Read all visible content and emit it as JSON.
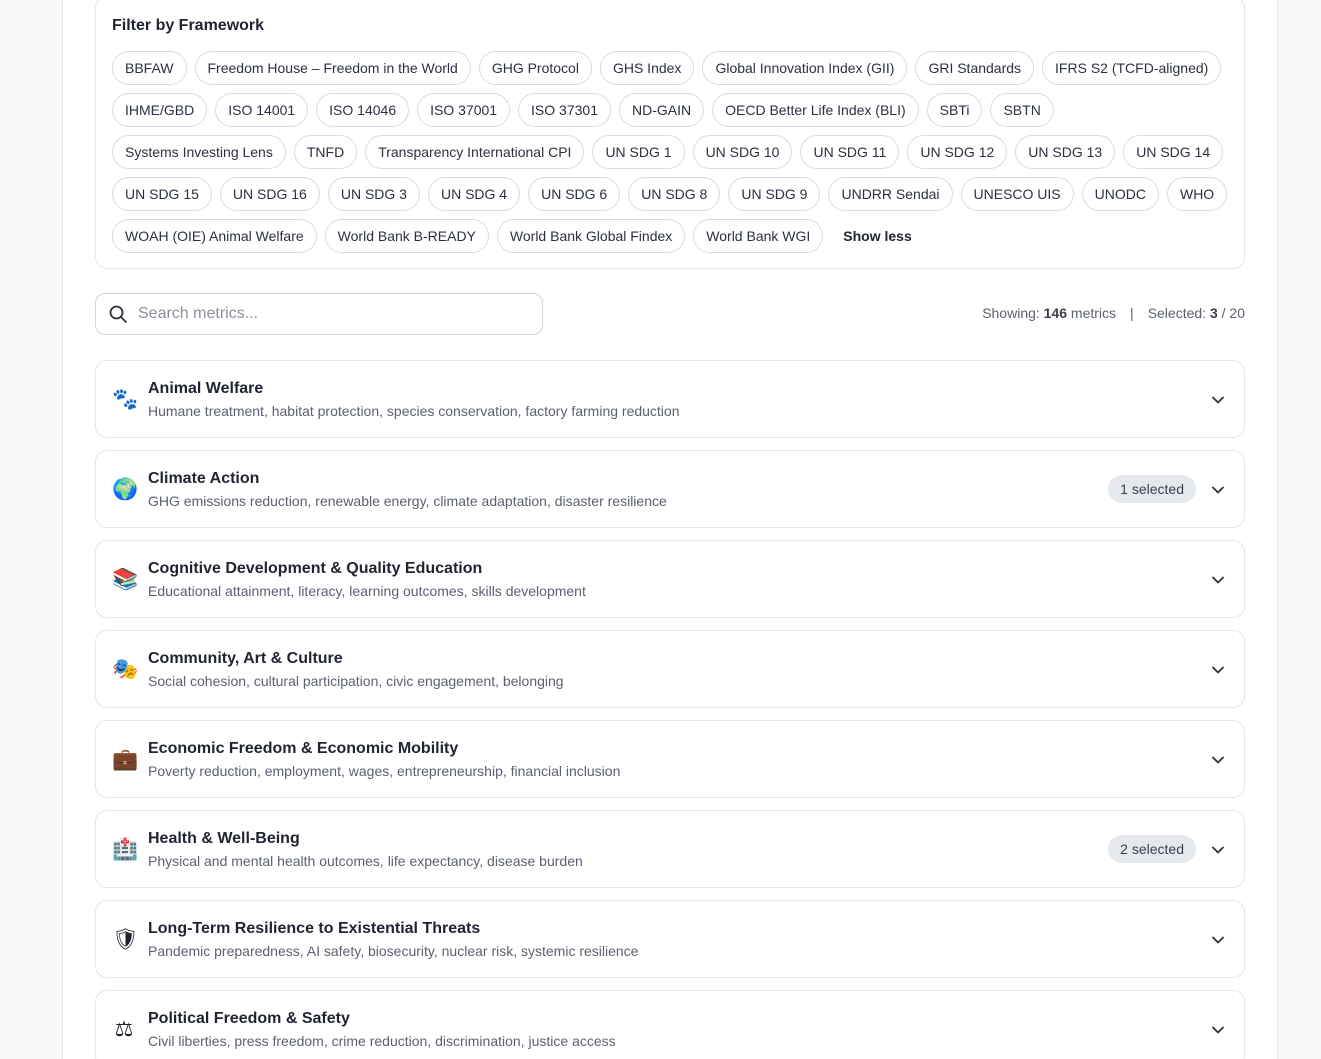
{
  "filter": {
    "title": "Filter by Framework",
    "chips": [
      "BBFAW",
      "Freedom House – Freedom in the World",
      "GHG Protocol",
      "GHS Index",
      "Global Innovation Index (GII)",
      "GRI Standards",
      "IFRS S2 (TCFD-aligned)",
      "IHME/GBD",
      "ISO 14001",
      "ISO 14046",
      "ISO 37001",
      "ISO 37301",
      "ND-GAIN",
      "OECD Better Life Index (BLI)",
      "SBTi",
      "SBTN",
      "Systems Investing Lens",
      "TNFD",
      "Transparency International CPI",
      "UN SDG 1",
      "UN SDG 10",
      "UN SDG 11",
      "UN SDG 12",
      "UN SDG 13",
      "UN SDG 14",
      "UN SDG 15",
      "UN SDG 16",
      "UN SDG 3",
      "UN SDG 4",
      "UN SDG 6",
      "UN SDG 8",
      "UN SDG 9",
      "UNDRR Sendai",
      "UNESCO UIS",
      "UNODC",
      "WHO",
      "WOAH (OIE) Animal Welfare",
      "World Bank B-READY",
      "World Bank Global Findex",
      "World Bank WGI"
    ],
    "show_less_label": "Show less"
  },
  "search": {
    "placeholder": "Search metrics..."
  },
  "stats": {
    "showing_label": "Showing:",
    "showing_count": "146",
    "showing_unit": "metrics",
    "separator": "|",
    "selected_label": "Selected:",
    "selected_count": "3",
    "selected_total": "/ 20"
  },
  "categories": [
    {
      "icon": "🐾",
      "icon_name": "paw-prints-icon",
      "title": "Animal Welfare",
      "description": "Humane treatment, habitat protection, species conservation, factory farming reduction",
      "badge": ""
    },
    {
      "icon": "🌍",
      "icon_name": "globe-icon",
      "title": "Climate Action",
      "description": "GHG emissions reduction, renewable energy, climate adaptation, disaster resilience",
      "badge": "1 selected"
    },
    {
      "icon": "📚",
      "icon_name": "books-icon",
      "title": "Cognitive Development & Quality Education",
      "description": "Educational attainment, literacy, learning outcomes, skills development",
      "badge": ""
    },
    {
      "icon": "🎭",
      "icon_name": "theater-masks-icon",
      "title": "Community, Art & Culture",
      "description": "Social cohesion, cultural participation, civic engagement, belonging",
      "badge": ""
    },
    {
      "icon": "💼",
      "icon_name": "briefcase-icon",
      "title": "Economic Freedom & Economic Mobility",
      "description": "Poverty reduction, employment, wages, entrepreneurship, financial inclusion",
      "badge": ""
    },
    {
      "icon": "🏥",
      "icon_name": "hospital-icon",
      "title": "Health & Well-Being",
      "description": "Physical and mental health outcomes, life expectancy, disease burden",
      "badge": "2 selected"
    },
    {
      "icon": "🛡",
      "icon_name": "shield-icon",
      "title": "Long-Term Resilience to Existential Threats",
      "description": "Pandemic preparedness, AI safety, biosecurity, nuclear risk, systemic resilience",
      "badge": ""
    },
    {
      "icon": "⚖",
      "icon_name": "scales-icon",
      "title": "Political Freedom & Safety",
      "description": "Civil liberties, press freedom, crime reduction, discrimination, justice access",
      "badge": ""
    }
  ]
}
